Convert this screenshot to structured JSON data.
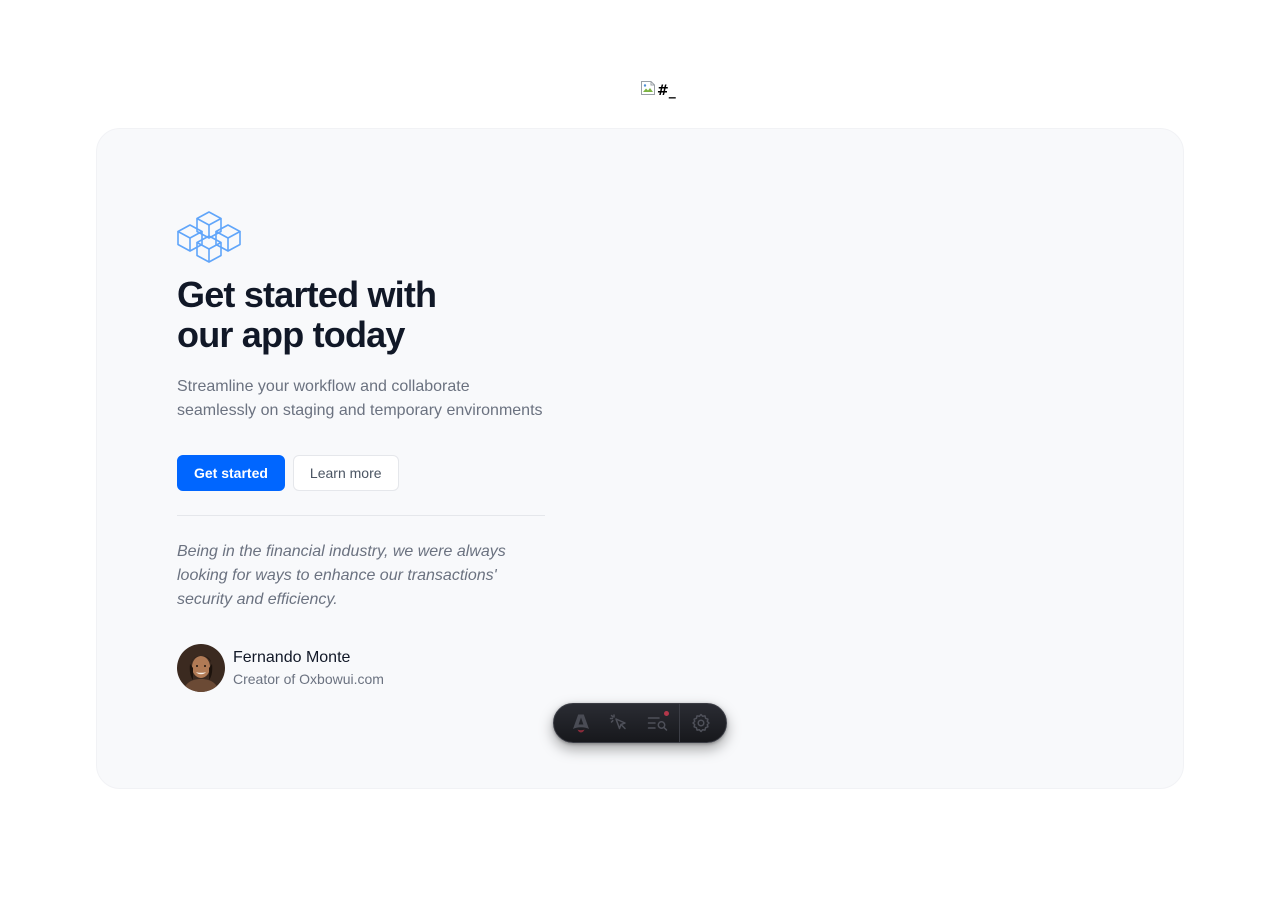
{
  "broken_image": {
    "alt": "#_"
  },
  "hero": {
    "headline": "Get started with\nour app today",
    "subtitle": "Streamline your workflow and collaborate seamlessly on staging and temporary environments",
    "primary_button": "Get started",
    "secondary_button": "Learn more",
    "quote": "Being in the financial industry, we were always looking for ways to enhance our transactions' security and efficiency.",
    "author": {
      "name": "Fernando Monte",
      "role": "Creator of Oxbowui.com"
    }
  },
  "dev_toolbar": {
    "items": [
      "astro-logo-icon",
      "inspect-cursor-icon",
      "audit-list-icon",
      "settings-gear-icon"
    ],
    "notification_color": "#b3374a"
  },
  "colors": {
    "accent": "#0066ff",
    "logo_blue": "#60a5fa",
    "heading": "#111827",
    "muted": "#6b7280",
    "card_bg": "#f8f9fb"
  }
}
